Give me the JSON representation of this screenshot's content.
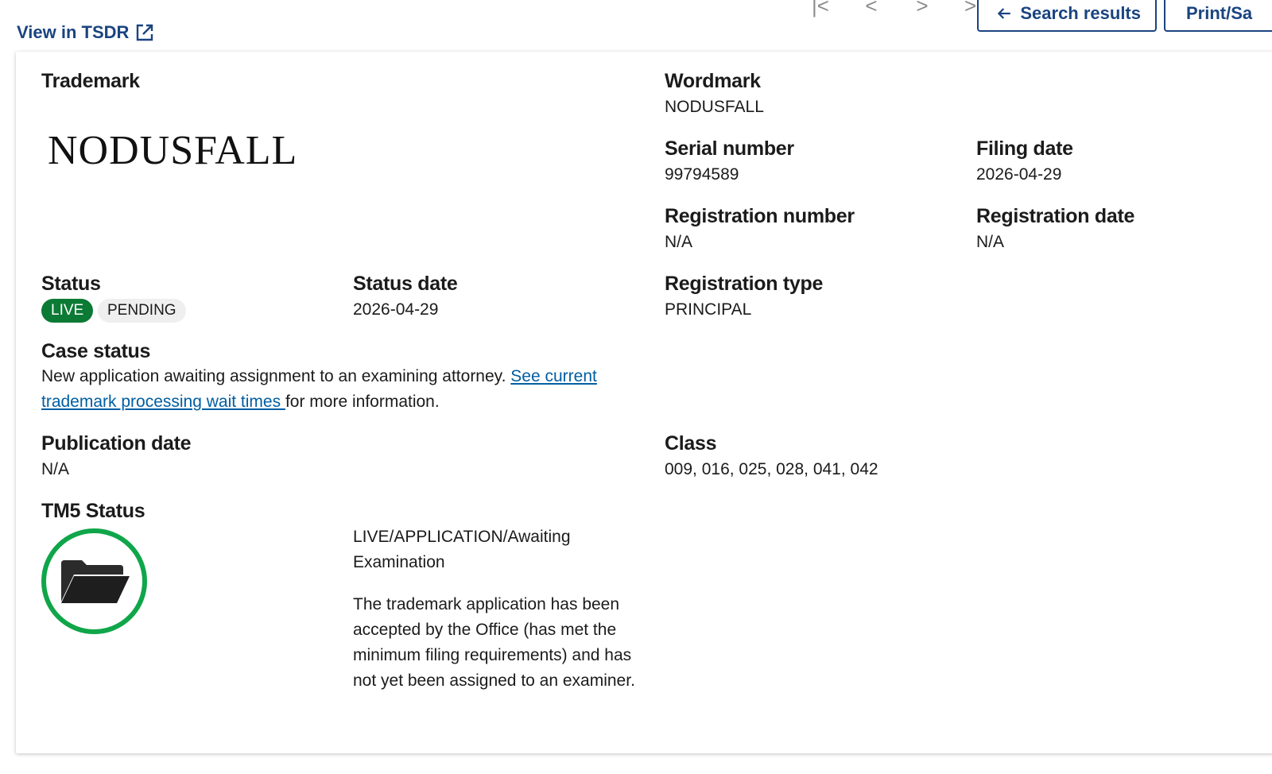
{
  "header": {
    "tsdr_link": "View in TSDR",
    "search_results_button": "Search results",
    "print_button": "Print/Sa"
  },
  "trademark": {
    "label": "Trademark",
    "mark_text": "NODUSFALL"
  },
  "wordmark": {
    "label": "Wordmark",
    "value": "NODUSFALL"
  },
  "serial": {
    "label": "Serial number",
    "value": "99794589"
  },
  "filing_date": {
    "label": "Filing date",
    "value": "2026-04-29"
  },
  "registration_number": {
    "label": "Registration number",
    "value": "N/A"
  },
  "registration_date": {
    "label": "Registration date",
    "value": "N/A"
  },
  "status": {
    "label": "Status",
    "badge_live": "LIVE",
    "badge_pending": "PENDING"
  },
  "status_date": {
    "label": "Status date",
    "value": "2026-04-29"
  },
  "registration_type": {
    "label": "Registration type",
    "value": "PRINCIPAL"
  },
  "case_status": {
    "label": "Case status",
    "text_before": "New application awaiting assignment to an examining attorney. ",
    "link_text": "See current trademark processing wait times ",
    "text_after": "for more information."
  },
  "publication_date": {
    "label": "Publication date",
    "value": "N/A"
  },
  "class": {
    "label": "Class",
    "value": "009, 016, 025, 028, 041, 042"
  },
  "tm5": {
    "label": "TM5 Status",
    "status_text": "LIVE/APPLICATION/Awaiting Examination",
    "description": "The trademark application has been accepted by the Office (has met the minimum filing requirements) and has not yet been assigned to an examiner."
  },
  "colors": {
    "link_blue": "#1a4480",
    "live_green": "#0b7a34",
    "tm5_ring_green": "#0fa64a"
  }
}
